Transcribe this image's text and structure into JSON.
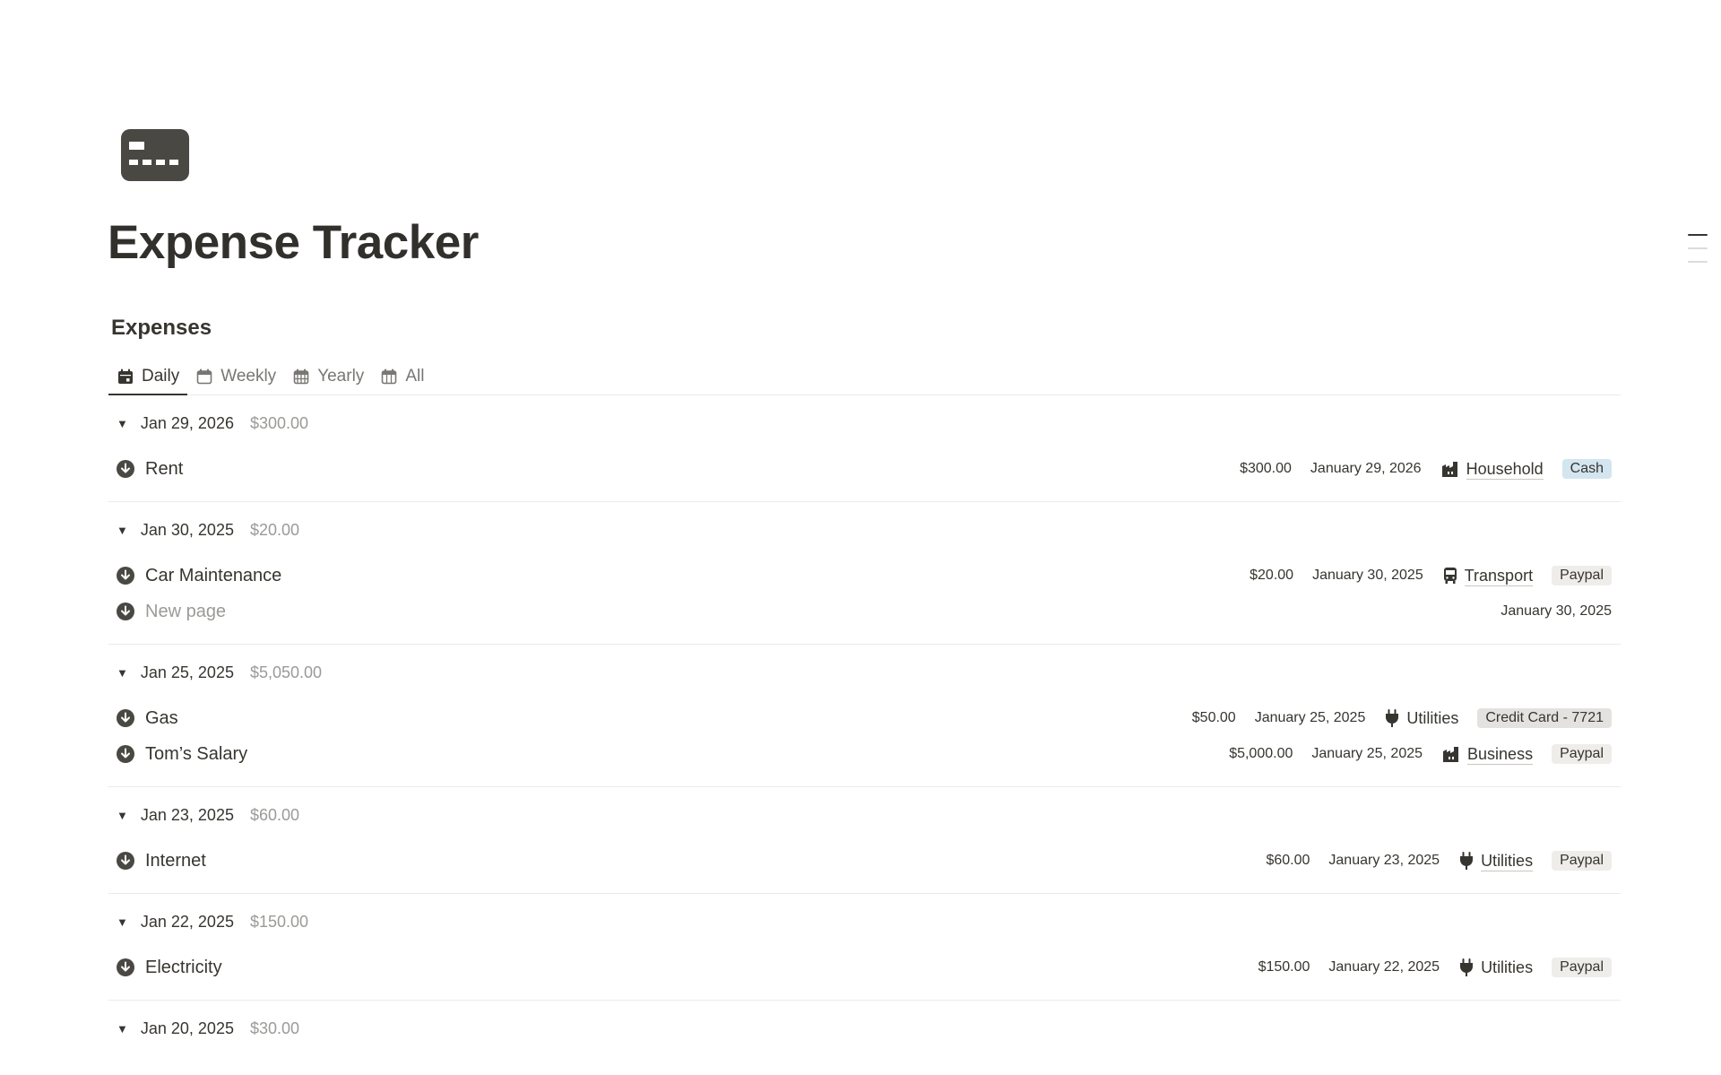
{
  "page": {
    "title": "Expense Tracker",
    "icon": "credit-card-icon"
  },
  "database": {
    "title": "Expenses"
  },
  "tabs": [
    {
      "label": "Daily",
      "icon": "calendar-day-icon",
      "active": true
    },
    {
      "label": "Weekly",
      "icon": "calendar-week-icon",
      "active": false
    },
    {
      "label": "Yearly",
      "icon": "calendar-year-icon",
      "active": false
    },
    {
      "label": "All",
      "icon": "calendar-all-icon",
      "active": false
    }
  ],
  "groups": [
    {
      "date": "Jan 29, 2026",
      "total": "$300.00",
      "rows": [
        {
          "name": "Rent",
          "amount": "$300.00",
          "date": "January 29, 2026",
          "category": "Household",
          "category_icon": "building-icon",
          "payment": "Cash",
          "payment_color": "#d3e5ef"
        }
      ]
    },
    {
      "date": "Jan 30, 2025",
      "total": "$20.00",
      "rows": [
        {
          "name": "Car Maintenance",
          "amount": "$20.00",
          "date": "January 30, 2025",
          "category": "Transport",
          "category_icon": "bus-icon",
          "payment": "Paypal",
          "payment_color": "#eeede9"
        },
        {
          "name": "New page",
          "amount": "",
          "date": "January 30, 2025",
          "category": "",
          "category_icon": "",
          "payment": "",
          "placeholder": true
        }
      ]
    },
    {
      "date": "Jan 25, 2025",
      "total": "$5,050.00",
      "rows": [
        {
          "name": "Gas",
          "amount": "$50.00",
          "date": "January 25, 2025",
          "category": "Utilities",
          "category_icon": "plug-icon",
          "payment": "Credit Card - 7721",
          "payment_color": "#e3e2e0"
        },
        {
          "name": "Tom’s Salary",
          "amount": "$5,000.00",
          "date": "January 25, 2025",
          "category": "Business",
          "category_icon": "building-icon",
          "payment": "Paypal",
          "payment_color": "#eeede9"
        }
      ]
    },
    {
      "date": "Jan 23, 2025",
      "total": "$60.00",
      "rows": [
        {
          "name": "Internet",
          "amount": "$60.00",
          "date": "January 23, 2025",
          "category": "Utilities",
          "category_icon": "plug-icon",
          "payment": "Paypal",
          "payment_color": "#eeede9"
        }
      ]
    },
    {
      "date": "Jan 22, 2025",
      "total": "$150.00",
      "rows": [
        {
          "name": "Electricity",
          "amount": "$150.00",
          "date": "January 22, 2025",
          "category": "Utilities",
          "category_icon": "plug-icon",
          "payment": "Paypal",
          "payment_color": "#eeede9"
        }
      ]
    },
    {
      "date": "Jan 20, 2025",
      "total": "$30.00",
      "rows": []
    }
  ]
}
